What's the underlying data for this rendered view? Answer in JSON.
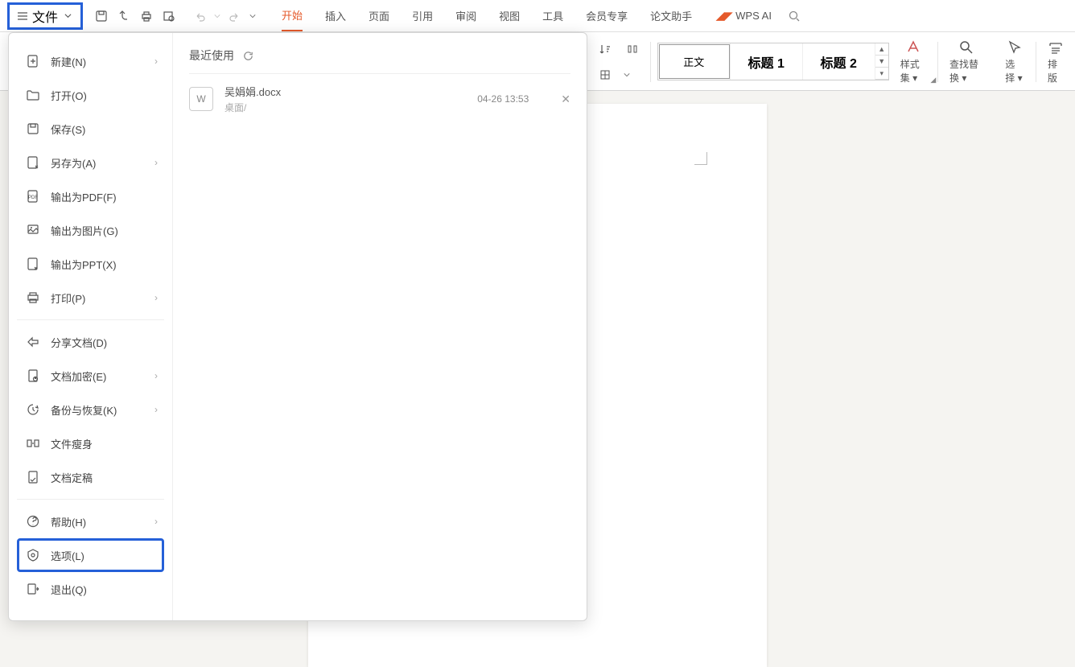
{
  "toolbar": {
    "file_label": "文件"
  },
  "tabs": [
    "开始",
    "插入",
    "页面",
    "引用",
    "审阅",
    "视图",
    "工具",
    "会员专享",
    "论文助手"
  ],
  "ai_label": "WPS AI",
  "ribbon": {
    "styles": [
      "正文",
      "标题 1",
      "标题 2"
    ],
    "style_set": "样式集",
    "find_replace": "查找替换",
    "select": "选择",
    "layout": "排版"
  },
  "file_menu": {
    "items": [
      {
        "label": "新建(N)",
        "arrow": true
      },
      {
        "label": "打开(O)",
        "arrow": false
      },
      {
        "label": "保存(S)",
        "arrow": false
      },
      {
        "label": "另存为(A)",
        "arrow": true
      },
      {
        "label": "输出为PDF(F)",
        "arrow": false
      },
      {
        "label": "输出为图片(G)",
        "arrow": false
      },
      {
        "label": "输出为PPT(X)",
        "arrow": false
      },
      {
        "label": "打印(P)",
        "arrow": true
      },
      {
        "sep": true
      },
      {
        "label": "分享文档(D)",
        "arrow": false
      },
      {
        "label": "文档加密(E)",
        "arrow": true
      },
      {
        "label": "备份与恢复(K)",
        "arrow": true
      },
      {
        "label": "文件瘦身",
        "arrow": false
      },
      {
        "label": "文档定稿",
        "arrow": false
      },
      {
        "sep": true
      },
      {
        "label": "帮助(H)",
        "arrow": true
      },
      {
        "label": "选项(L)",
        "arrow": false,
        "highlight": true
      },
      {
        "label": "退出(Q)",
        "arrow": false
      }
    ],
    "recent_title": "最近使用",
    "recent": [
      {
        "name": "吴娟娟.docx",
        "path": "桌面/",
        "date": "04-26 13:53"
      }
    ]
  }
}
